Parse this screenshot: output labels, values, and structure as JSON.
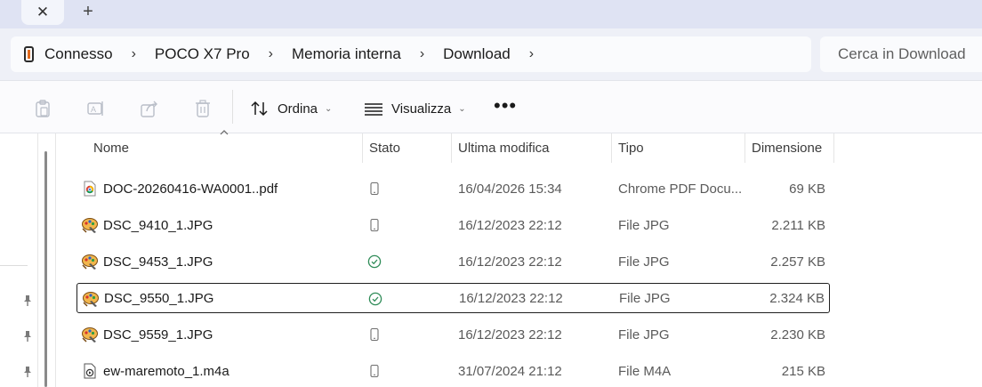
{
  "tabs": {
    "close_icon": "close-icon",
    "new_icon": "plus-icon"
  },
  "breadcrumb": {
    "items": [
      "Connesso",
      "POCO X7 Pro",
      "Memoria interna",
      "Download"
    ],
    "separator": ">"
  },
  "search": {
    "placeholder": "Cerca in Download"
  },
  "toolbar": {
    "sort_label": "Ordina",
    "view_label": "Visualizza",
    "more_label": "•••"
  },
  "columns": {
    "name": "Nome",
    "status": "Stato",
    "modified": "Ultima modifica",
    "type": "Tipo",
    "size": "Dimensione"
  },
  "files": [
    {
      "name": "DOC-20260416-WA0001..pdf",
      "status": "device",
      "modified": "16/04/2026 15:34",
      "type": "Chrome PDF Docu...",
      "size": "69 KB",
      "icon": "pdf-icon",
      "selected": false
    },
    {
      "name": "DSC_9410_1.JPG",
      "status": "device",
      "modified": "16/12/2023 22:12",
      "type": "File JPG",
      "size": "2.211 KB",
      "icon": "image-icon",
      "selected": false
    },
    {
      "name": "DSC_9453_1.JPG",
      "status": "synced",
      "modified": "16/12/2023 22:12",
      "type": "File JPG",
      "size": "2.257 KB",
      "icon": "image-icon",
      "selected": false
    },
    {
      "name": "DSC_9550_1.JPG",
      "status": "synced",
      "modified": "16/12/2023 22:12",
      "type": "File JPG",
      "size": "2.324 KB",
      "icon": "image-icon",
      "selected": true
    },
    {
      "name": "DSC_9559_1.JPG",
      "status": "device",
      "modified": "16/12/2023 22:12",
      "type": "File JPG",
      "size": "2.230 KB",
      "icon": "image-icon",
      "selected": false
    },
    {
      "name": "ew-maremoto_1.m4a",
      "status": "device",
      "modified": "31/07/2024 21:12",
      "type": "File M4A",
      "size": "215 KB",
      "icon": "audio-icon",
      "selected": false
    }
  ],
  "colors": {
    "accent": "#0f6cbd",
    "synced_green": "#2e8b57",
    "tabstrip_bg": "#dfe3f3"
  }
}
